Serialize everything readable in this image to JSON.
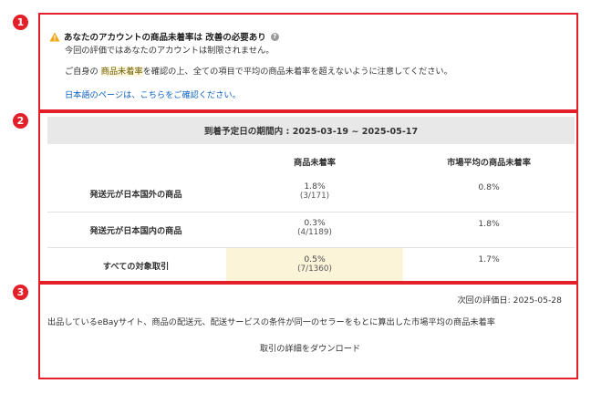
{
  "badges": [
    "1",
    "2",
    "3"
  ],
  "notice": {
    "title": "あなたのアカウントの商品未着率は 改善の必要あり",
    "line1": "今回の評価ではあなたのアカウントは制限されません。",
    "line2_pre": "ご自身の ",
    "line2_highlight": "商品未着率",
    "line2_post": "を確認の上、全ての項目で平均の商品未着率を超えないように注意してください。",
    "link": "日本語のページは、こちらをご確認ください。"
  },
  "table": {
    "period": "到着予定日の期間内 : 2025-03-19 ~ 2025-05-17",
    "col1": "商品未着率",
    "col2": "市場平均の商品未着率",
    "rows": [
      {
        "label": "発送元が日本国外の商品",
        "rate": "1.8%",
        "count": "(3/171)",
        "market": "0.8%"
      },
      {
        "label": "発送元が日本国内の商品",
        "rate": "0.3%",
        "count": "(4/1189)",
        "market": "1.8%"
      },
      {
        "label": "すべての対象取引",
        "rate": "0.5%",
        "count": "(7/1360)",
        "market": "1.7%"
      }
    ]
  },
  "footer": {
    "next_eval": "次回の評価日: 2025-05-28",
    "description": "出品しているeBayサイト、商品の配送元、配送サービスの条件が同一のセラーをもとに算出した市場平均の商品未着率",
    "download": "取引の詳細をダウンロード"
  },
  "colors": {
    "border": "#e3202a",
    "link": "#0d63c2",
    "highlight": "#fcf4d9",
    "header_bg": "#e8e8e9"
  }
}
